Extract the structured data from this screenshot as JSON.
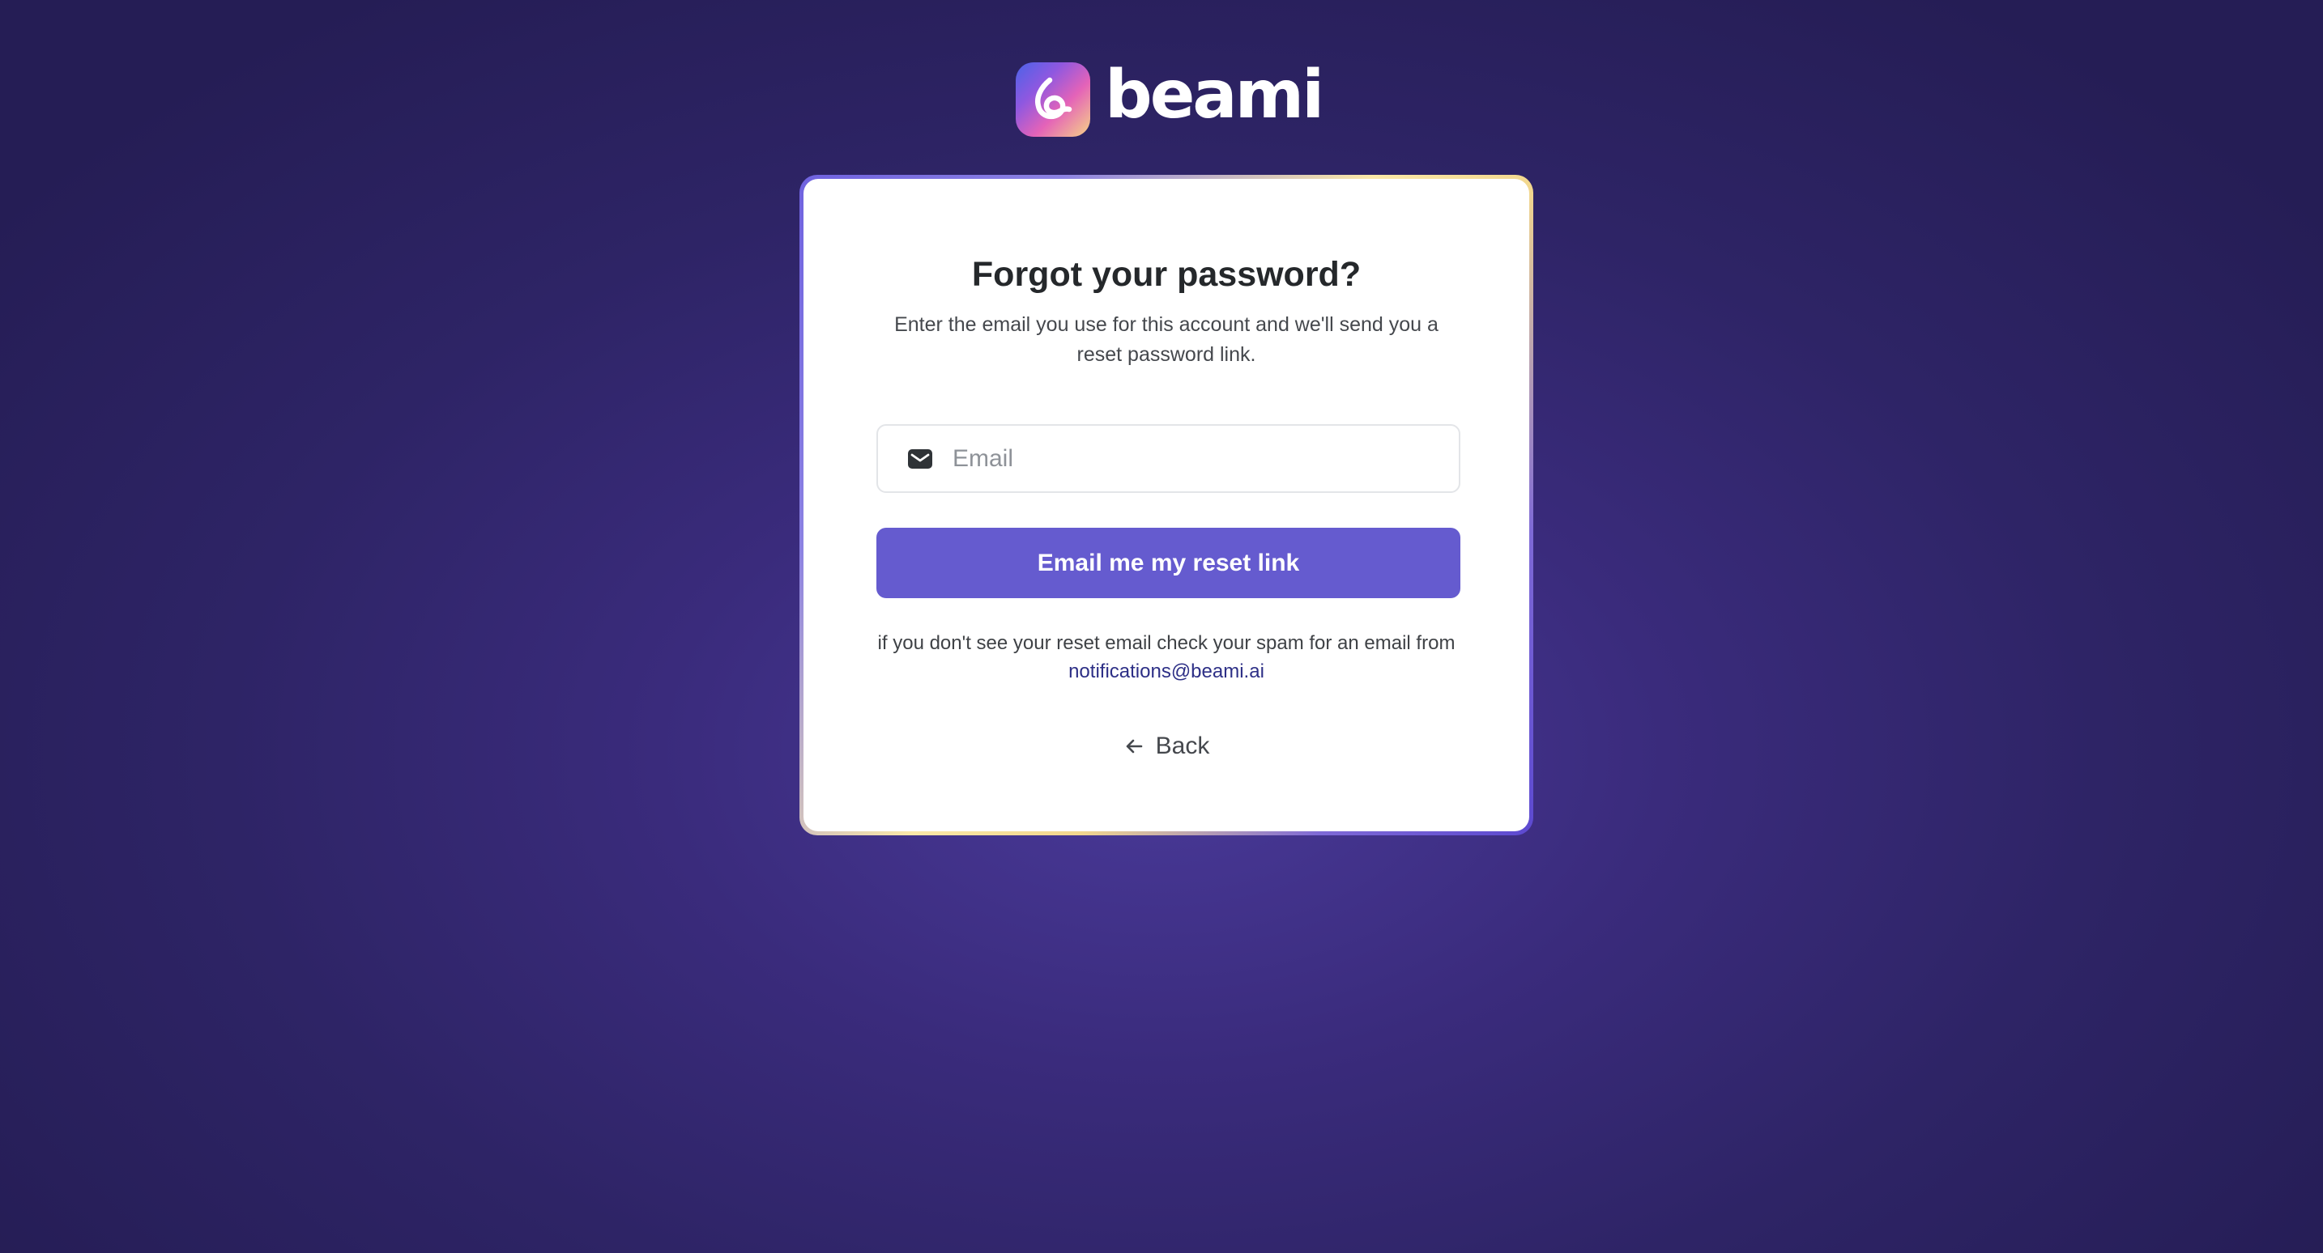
{
  "brand": {
    "name": "beami",
    "logo_icon": "beami-logo-icon"
  },
  "colors": {
    "primary_button": "#655bcf",
    "link": "#2d2f86",
    "heading": "#25282b",
    "background_center": "#4a3a9a",
    "background_edge": "#251d55"
  },
  "form": {
    "title": "Forgot your password?",
    "subtitle": "Enter the email you use for this account and we'll send you a reset password link.",
    "email_field": {
      "icon": "envelope-icon",
      "value": "",
      "placeholder": "Email"
    },
    "submit_label": "Email me my reset link",
    "hint_text": "if you don't see your reset email check your spam for an email from",
    "hint_email": "notifications@beami.ai",
    "back": {
      "icon": "arrow-left-icon",
      "label": "Back"
    }
  }
}
